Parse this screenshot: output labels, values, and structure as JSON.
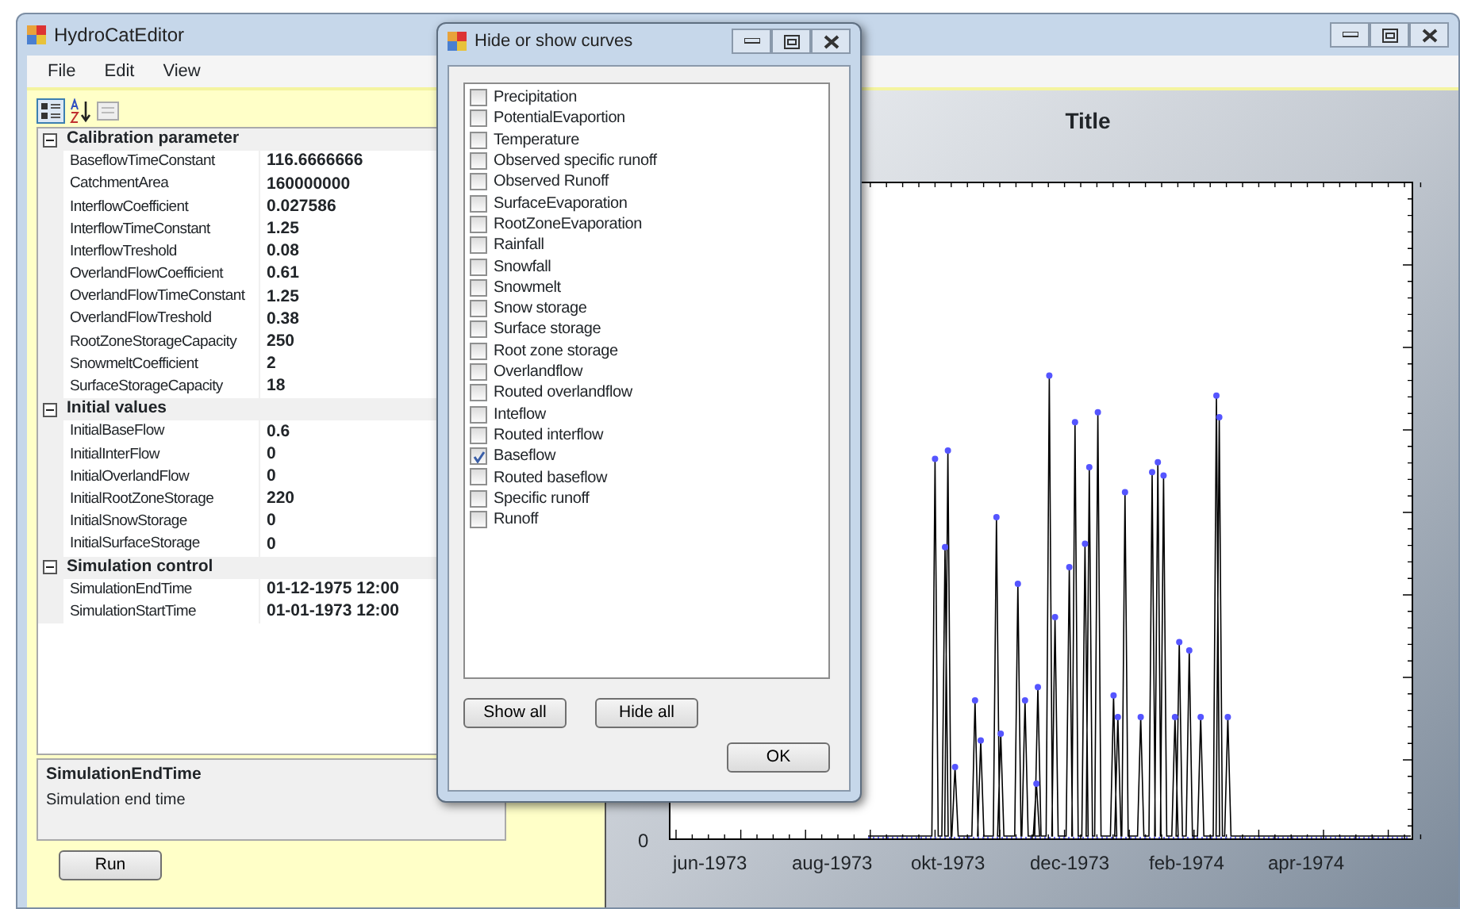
{
  "window": {
    "title": "HydroCatEditor"
  },
  "menu": [
    "File",
    "Edit",
    "View"
  ],
  "property_grid": {
    "categories": [
      {
        "name": "Calibration parameter",
        "expanded": true,
        "properties": [
          {
            "name": "BaseflowTimeConstant",
            "value": "116.6666666"
          },
          {
            "name": "CatchmentArea",
            "value": "160000000"
          },
          {
            "name": "InterflowCoefficient",
            "value": "0.027586"
          },
          {
            "name": "InterflowTimeConstant",
            "value": "1.25"
          },
          {
            "name": "InterflowTreshold",
            "value": "0.08"
          },
          {
            "name": "OverlandFlowCoefficient",
            "value": "0.61"
          },
          {
            "name": "OverlandFlowTimeConstant",
            "value": "1.25"
          },
          {
            "name": "OverlandFlowTreshold",
            "value": "0.38"
          },
          {
            "name": "RootZoneStorageCapacity",
            "value": "250"
          },
          {
            "name": "SnowmeltCoefficient",
            "value": "2"
          },
          {
            "name": "SurfaceStorageCapacity",
            "value": "18"
          }
        ]
      },
      {
        "name": "Initial values",
        "expanded": true,
        "properties": [
          {
            "name": "InitialBaseFlow",
            "value": "0.6"
          },
          {
            "name": "InitialInterFlow",
            "value": "0"
          },
          {
            "name": "InitialOverlandFlow",
            "value": "0"
          },
          {
            "name": "InitialRootZoneStorage",
            "value": "220"
          },
          {
            "name": "InitialSnowStorage",
            "value": "0"
          },
          {
            "name": "InitialSurfaceStorage",
            "value": "0"
          }
        ]
      },
      {
        "name": "Simulation control",
        "expanded": true,
        "properties": [
          {
            "name": "SimulationEndTime",
            "value": "01-12-1975 12:00"
          },
          {
            "name": "SimulationStartTime",
            "value": "01-01-1973 12:00"
          }
        ]
      }
    ],
    "description": {
      "title": "SimulationEndTime",
      "text": "Simulation end time"
    }
  },
  "run_button": "Run",
  "chart": {
    "title": "Title",
    "y_label": "0",
    "x_labels": [
      "jun-1973",
      "aug-1973",
      "okt-1973",
      "dec-1973",
      "feb-1974",
      "apr-1974"
    ]
  },
  "dialog": {
    "title": "Hide or show curves",
    "curves": [
      {
        "label": "Precipitation",
        "checked": false
      },
      {
        "label": "PotentialEvaportion",
        "checked": false
      },
      {
        "label": "Temperature",
        "checked": false
      },
      {
        "label": "Observed specific runoff",
        "checked": false
      },
      {
        "label": "Observed Runoff",
        "checked": false
      },
      {
        "label": "SurfaceEvaporation",
        "checked": false
      },
      {
        "label": "RootZoneEvaporation",
        "checked": false
      },
      {
        "label": "Rainfall",
        "checked": false
      },
      {
        "label": "Snowfall",
        "checked": false
      },
      {
        "label": "Snowmelt",
        "checked": false
      },
      {
        "label": "Snow storage",
        "checked": false
      },
      {
        "label": "Surface storage",
        "checked": false
      },
      {
        "label": "Root zone storage",
        "checked": false
      },
      {
        "label": "Overlandflow",
        "checked": false
      },
      {
        "label": "Routed overlandflow",
        "checked": false
      },
      {
        "label": "Inteflow",
        "checked": false
      },
      {
        "label": "Routed interflow",
        "checked": false
      },
      {
        "label": "Baseflow",
        "checked": true
      },
      {
        "label": "Routed baseflow",
        "checked": false
      },
      {
        "label": "Specific runoff",
        "checked": false
      },
      {
        "label": "Runoff",
        "checked": false
      }
    ],
    "buttons": [
      "Show all",
      "Hide all"
    ],
    "ok_button": "OK"
  }
}
